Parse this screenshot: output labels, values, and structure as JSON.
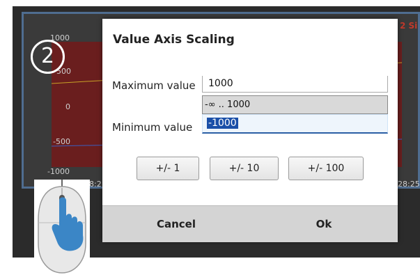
{
  "step_number": "2",
  "chart": {
    "y_ticks": [
      "1000",
      "500",
      "0",
      "-500",
      "-1000"
    ],
    "x_tick_left": "28:2",
    "x_tick_right": "28:25.",
    "legend_right": "2 Si",
    "plot_color": "#6a1e1e",
    "frame_color": "#4f6d90"
  },
  "dialog": {
    "title": "Value Axis Scaling",
    "max_label": "Maximum value",
    "max_value": "1000",
    "range_hint": "-∞ .. 1000",
    "min_label": "Minimum value",
    "min_value": "-1000",
    "buttons": [
      "+/- 1",
      "+/- 10",
      "+/- 100"
    ],
    "cancel": "Cancel",
    "ok": "Ok"
  },
  "icons": {
    "mouse": "mouse-click-icon",
    "step": "step-2-badge"
  },
  "colors": {
    "accent": "#2a5fa5",
    "hand": "#3b86c6"
  }
}
